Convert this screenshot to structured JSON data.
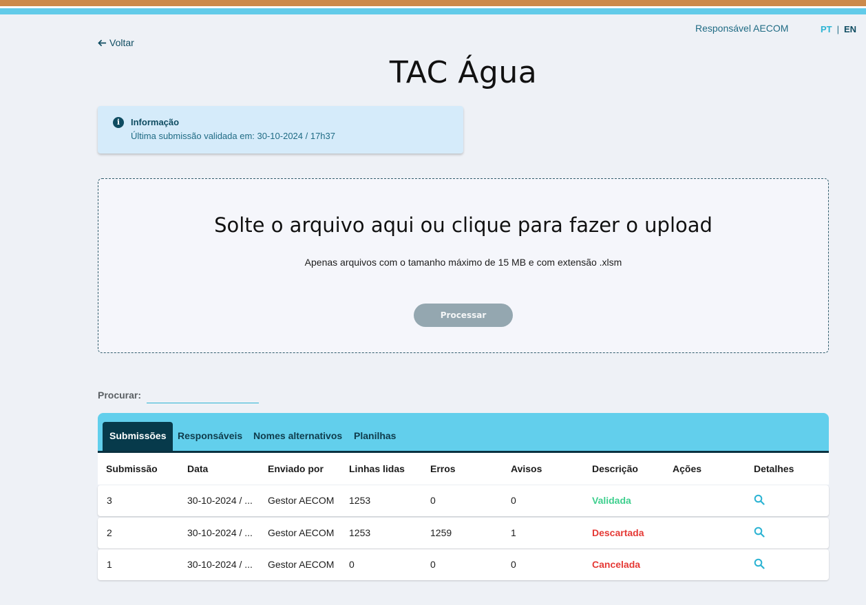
{
  "header": {
    "responsible": "Responsável AECOM",
    "lang_pt": "PT",
    "lang_sep": "|",
    "lang_en": "EN",
    "back_label": "Voltar",
    "title": "TAC Água"
  },
  "info": {
    "title": "Informação",
    "text": "Última submissão validada em: 30-10-2024 / 17h37"
  },
  "upload": {
    "title": "Solte o arquivo aqui ou clique para fazer o upload",
    "subtitle": "Apenas arquivos com o tamanho máximo de 15 MB e com extensão .xlsm",
    "process_label": "Processar"
  },
  "search": {
    "label": "Procurar:",
    "value": ""
  },
  "tabs": [
    {
      "label": "Submissões",
      "active": true
    },
    {
      "label": "Responsáveis",
      "active": false
    },
    {
      "label": "Nomes alternativos",
      "active": false
    },
    {
      "label": "Planilhas",
      "active": false
    }
  ],
  "table": {
    "columns": [
      "Submissão",
      "Data",
      "Enviado por",
      "Linhas lidas",
      "Erros",
      "Avisos",
      "Descrição",
      "Ações",
      "Detalhes"
    ],
    "rows": [
      {
        "submission": "3",
        "date": "30-10-2024 / ...",
        "sent_by": "Gestor AECOM",
        "lines": "1253",
        "errors": "0",
        "warnings": "0",
        "description": "Validada",
        "status": "green"
      },
      {
        "submission": "2",
        "date": "30-10-2024 / ...",
        "sent_by": "Gestor AECOM",
        "lines": "1253",
        "errors": "1259",
        "warnings": "1",
        "description": "Descartada",
        "status": "red"
      },
      {
        "submission": "1",
        "date": "30-10-2024 / ...",
        "sent_by": "Gestor AECOM",
        "lines": "0",
        "errors": "0",
        "warnings": "0",
        "description": "Cancelada",
        "status": "red"
      }
    ]
  },
  "colors": {
    "accent": "#62cfec",
    "dark": "#073a4b",
    "valid": "#3ecf8e",
    "rejected": "#e53935",
    "stripe_top": "#cc8a4b"
  }
}
